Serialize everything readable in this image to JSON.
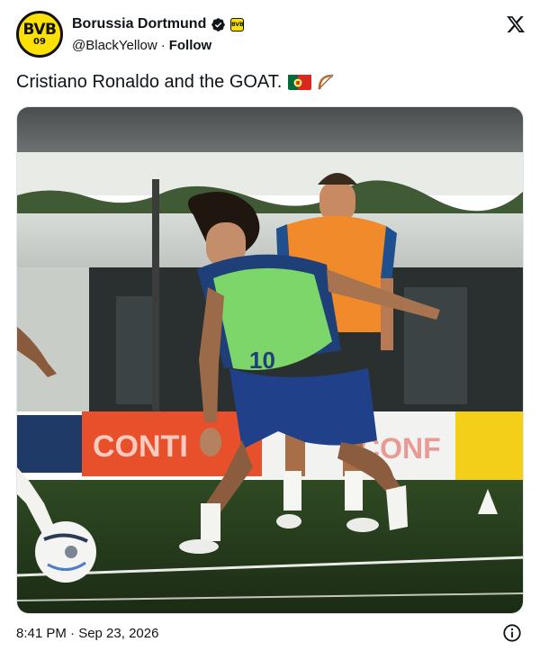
{
  "account": {
    "display_name": "Borussia Dortmund",
    "handle": "@BlackYellow",
    "follow_label": "Follow",
    "avatar_text": "BVB",
    "avatar_subtext": "09",
    "affiliate_badge_text": "BVB"
  },
  "tweet": {
    "text": "Cristiano Ronaldo and the GOAT.",
    "emojis": [
      "portugal-flag",
      "bow-and-arrow"
    ]
  },
  "media": {
    "alt": "Training photo of two players in bibs on a pitch",
    "player_front_number": "10",
    "board_text_left": "CONTI",
    "board_text_right": "CONF"
  },
  "footer": {
    "timestamp": "8:41 PM · Sep 23, 2026"
  },
  "colors": {
    "bvb_yellow": "#fde100",
    "verified_blue": "#1d9bf0",
    "text": "#0f1419"
  },
  "icons": [
    "verified-icon",
    "x-logo-icon",
    "info-icon"
  ]
}
